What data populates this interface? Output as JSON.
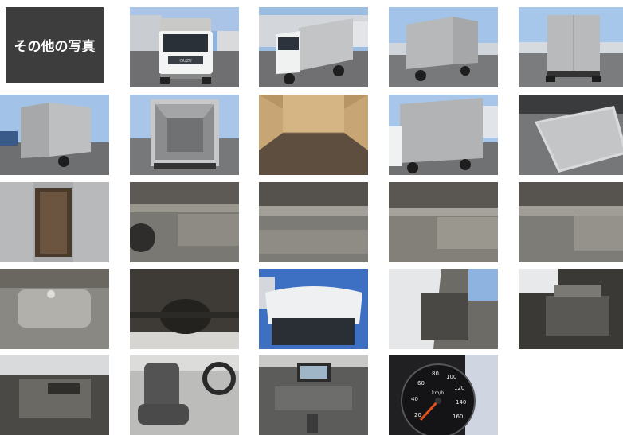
{
  "gallery": {
    "title": "その他の写真",
    "photos": [
      "truck-front-view",
      "truck-front-left-view",
      "truck-rear-left-view",
      "truck-rear-view",
      "truck-rear-left-angle",
      "cargo-box-rear-open",
      "cargo-box-interior",
      "truck-right-side-view",
      "tail-lift-platform",
      "cargo-side-door-open",
      "chassis-underside-front",
      "chassis-underside-mid",
      "chassis-underside-frame",
      "chassis-underside-rear",
      "fuel-tank",
      "rear-differential",
      "cab-roof-view",
      "cab-tilted-side",
      "engine-bay",
      "engine-closeup",
      "driver-seat",
      "dashboard-navigation",
      "speedometer"
    ]
  },
  "speedometer": {
    "ticks": [
      "20",
      "40",
      "60",
      "80",
      "100",
      "120",
      "140",
      "160"
    ],
    "unit": "km/h"
  },
  "truck": {
    "brand": "ISUZU"
  }
}
